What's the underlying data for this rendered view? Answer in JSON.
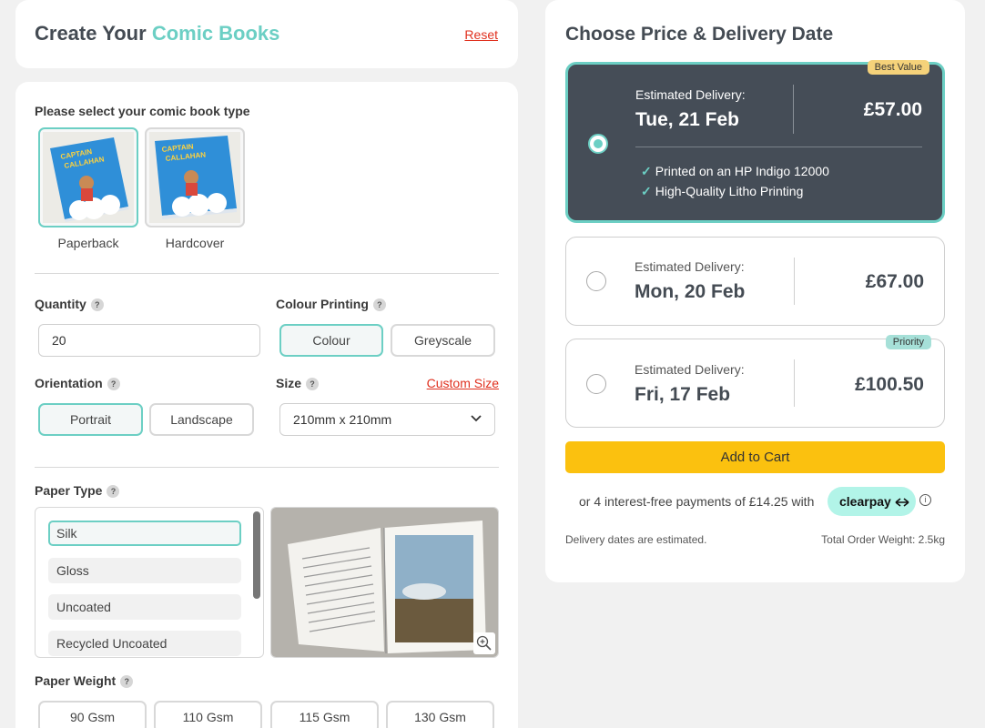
{
  "header": {
    "title_prefix": "Create Your",
    "title_accent": "Comic Books",
    "reset": "Reset"
  },
  "book_type": {
    "label": "Please select your comic book type",
    "options": [
      "Paperback",
      "Hardcover"
    ],
    "selected": "Paperback"
  },
  "quantity": {
    "label": "Quantity",
    "value": "20"
  },
  "colour_printing": {
    "label": "Colour Printing",
    "options": [
      "Colour",
      "Greyscale"
    ],
    "selected": "Colour"
  },
  "orientation": {
    "label": "Orientation",
    "options": [
      "Portrait",
      "Landscape"
    ],
    "selected": "Portrait"
  },
  "size": {
    "label": "Size",
    "custom_link": "Custom Size",
    "value": "210mm x 210mm"
  },
  "paper_type": {
    "label": "Paper Type",
    "options": [
      "Silk",
      "Gloss",
      "Uncoated",
      "Recycled Uncoated"
    ],
    "selected": "Silk"
  },
  "paper_weight": {
    "label": "Paper Weight",
    "options": [
      "90 Gsm",
      "110 Gsm",
      "115 Gsm",
      "130 Gsm"
    ]
  },
  "price_panel": {
    "title": "Choose Price & Delivery Date",
    "estimated_label": "Estimated Delivery:",
    "options": [
      {
        "date": "Tue, 21 Feb",
        "price": "£57.00",
        "badge": "Best Value",
        "selected": true,
        "features": [
          "Printed on an HP Indigo 12000",
          "High-Quality Litho Printing"
        ]
      },
      {
        "date": "Mon, 20 Feb",
        "price": "£67.00",
        "badge": "",
        "selected": false
      },
      {
        "date": "Fri, 17 Feb",
        "price": "£100.50",
        "badge": "Priority",
        "selected": false
      }
    ],
    "add_to_cart": "Add to Cart",
    "payments_text": "or 4 interest-free payments of £14.25 with",
    "clearpay": "clearpay",
    "info_icon": "i",
    "delivery_note": "Delivery dates are estimated.",
    "weight": "Total Order Weight: 2.5kg"
  },
  "colors": {
    "accent": "#6ccfc4",
    "dark_card": "#454d57",
    "cta": "#fbc10f",
    "link": "#e0301e"
  }
}
